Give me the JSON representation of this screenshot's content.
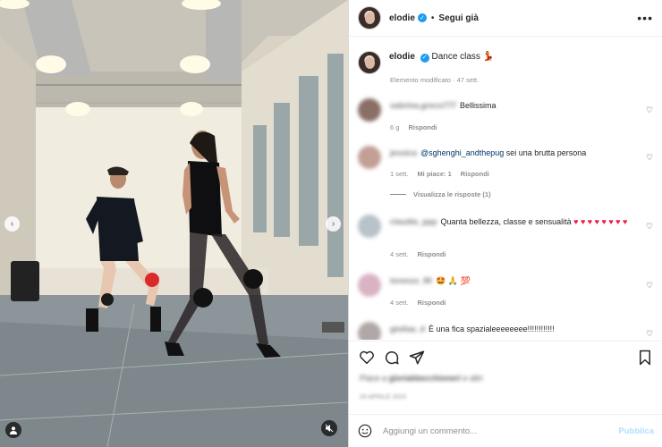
{
  "post": {
    "username": "elodie",
    "follow_label": "Segui già",
    "more_label": "•••",
    "caption_user": "elodie",
    "caption_text": "Dance class",
    "caption_emoji": "💃",
    "caption_meta": "Elemento modificato · 47 sett."
  },
  "comments": [
    {
      "user": "sabrina.greco777",
      "text": "Bellissima",
      "time": "6 g",
      "reply": "Rispondi",
      "likes": ""
    },
    {
      "user": "jessica",
      "mention": "@sghenghi_andthepug",
      "text": " sei una brutta persona",
      "time": "1 sett.",
      "likes": "Mi piace: 1",
      "reply": "Rispondi"
    },
    {
      "user": "claudia_ppp",
      "text": "Quanta bellezza, classe e sensualità ",
      "hearts": "♥ ♥ ♥ ♥ ♥ ♥ ♥ ♥",
      "time": "4 sett.",
      "reply": "Rispondi"
    },
    {
      "user": "lorenzo_90",
      "text": "🤩 🙏 💯",
      "time": "4 sett.",
      "reply": "Rispondi"
    },
    {
      "user": "giuliaa_d",
      "text": "È una fica spazialeeeeeeee!!!!!!!!!!!!"
    }
  ],
  "view_replies": "Visualizza le risposte (1)",
  "likes_prefix": "Piace a",
  "likes_user": "gloriabbecchioneri",
  "likes_suffix": "e altri",
  "post_date": "20 APRILE 2023",
  "add_comment": {
    "placeholder": "Aggiungi un commento...",
    "publish": "Pubblica"
  },
  "icons": [
    "heart-icon",
    "comment-icon",
    "share-icon",
    "bookmark-icon",
    "emoji-icon",
    "mute-icon",
    "tag-user-icon"
  ]
}
